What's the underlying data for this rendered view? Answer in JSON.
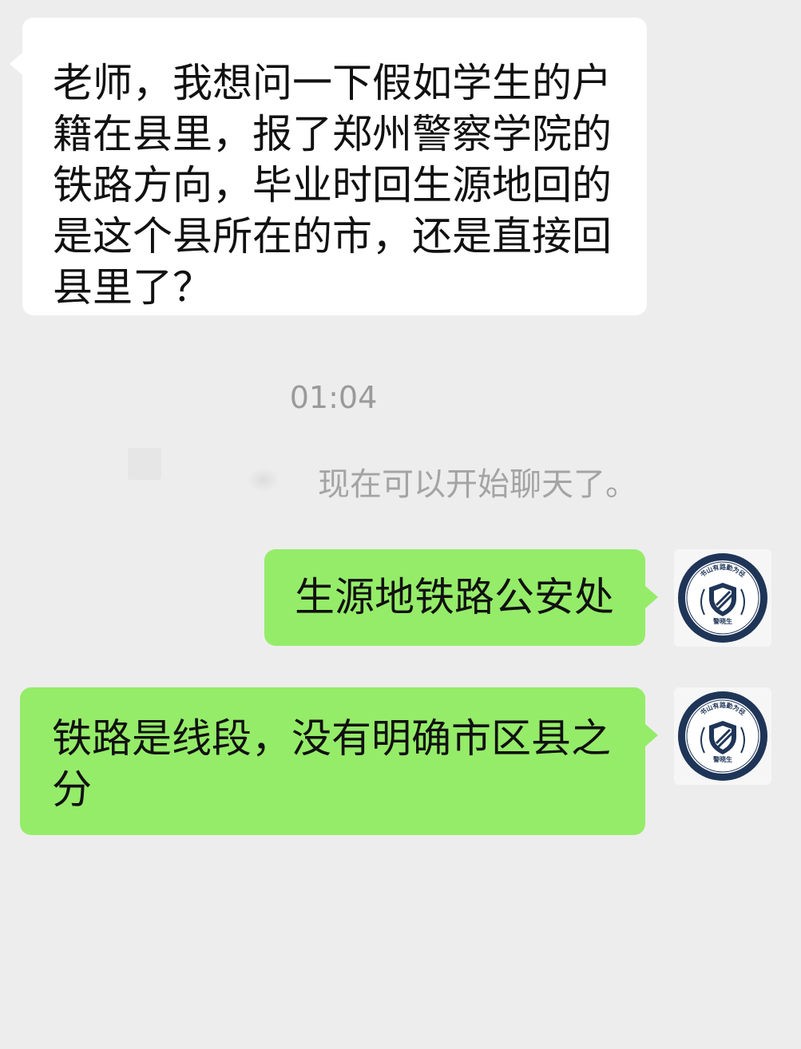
{
  "messages": {
    "incoming": {
      "text": "老师，我想问一下假如学生的户籍在县里，报了郑州警察学院的铁路方向，毕业时回生源地回的是这个县所在的市，还是直接回县里了？"
    },
    "timestamp": "01:04",
    "system_notice": "现在可以开始聊天了。",
    "outgoing": [
      {
        "text": "生源地铁路公安处"
      },
      {
        "text": "铁路是线段，没有明确市区县之分"
      }
    ]
  },
  "avatar": {
    "icon": "police-shield-logo-icon",
    "ring_text": "书山有路勤为径",
    "bottom_text": "警晓生",
    "colors": {
      "ring": "#1f3558",
      "inner": "#ffffff",
      "shield": "#1f3558"
    }
  },
  "colors": {
    "background": "#ededed",
    "incoming_bubble": "#ffffff",
    "outgoing_bubble": "#95ec69",
    "timestamp_text": "#9a9a9a"
  }
}
